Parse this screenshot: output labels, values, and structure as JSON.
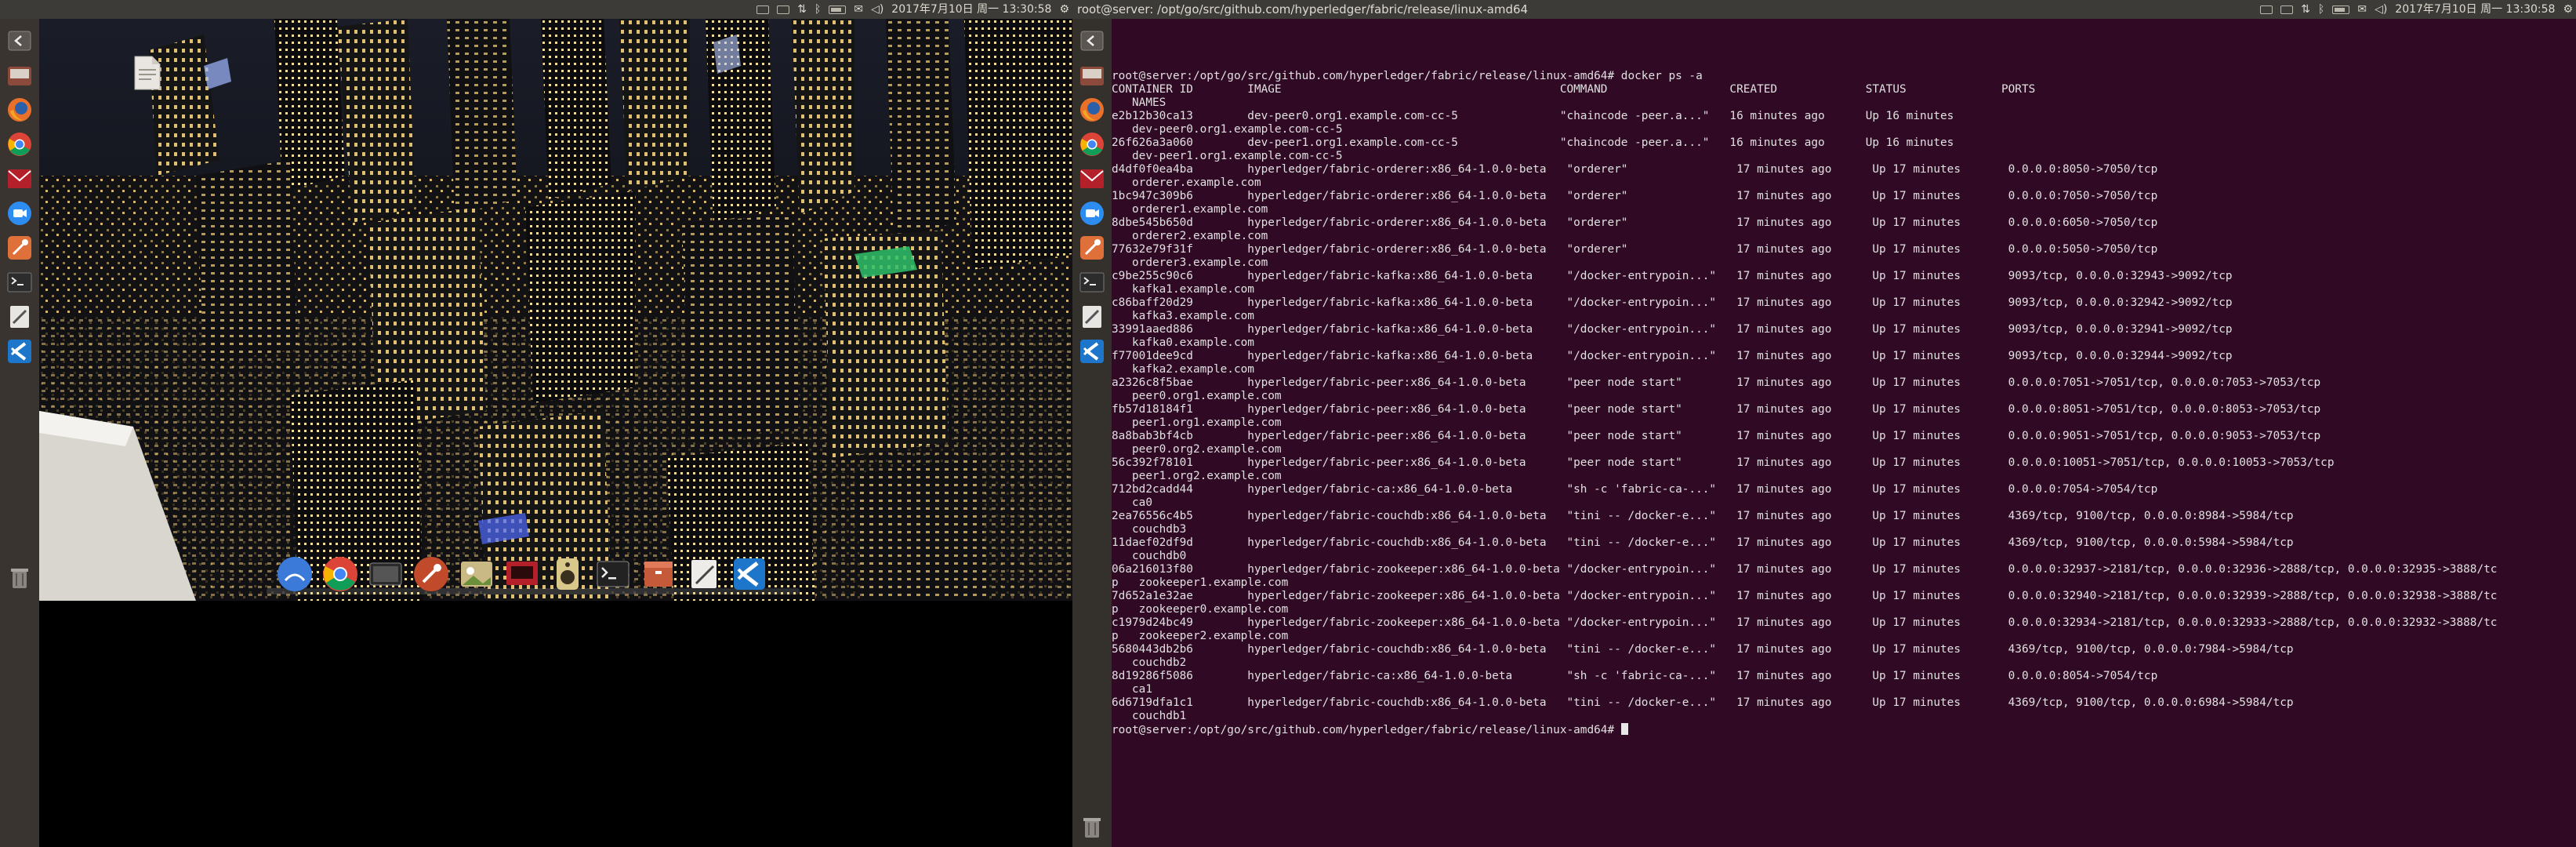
{
  "left_screen": {
    "topbar": {
      "title": "",
      "clock": "2017年7月10日 周一 13:30:58",
      "indicators": [
        "keyboard-icon",
        "network-icon",
        "sort-icon",
        "bluetooth-icon",
        "battery-icon",
        "mail-icon",
        "volume-icon"
      ]
    },
    "launcher_icons": [
      "back-icon",
      "files-icon",
      "firefox-icon",
      "chrome-icon",
      "mail-app-icon",
      "video-call-icon",
      "kite-icon",
      "terminal-icon",
      "editor-icon",
      "vscode-icon",
      "trash-icon"
    ],
    "dock_icons": [
      "finder-icon",
      "chrome-icon",
      "video-icon",
      "rocket-icon",
      "photos-icon",
      "slides-icon",
      "audio-icon",
      "terminal-icon",
      "archive-icon",
      "textedit-icon",
      "vscode-icon"
    ]
  },
  "right_screen": {
    "topbar": {
      "title": "root@server: /opt/go/src/github.com/hyperledger/fabric/release/linux-amd64",
      "clock": "2017年7月10日 周一 13:30:58"
    },
    "terminal": {
      "lines": [
        "root@server:/opt/go/src/github.com/hyperledger/fabric/release/linux-amd64# docker ps -a",
        "CONTAINER ID        IMAGE                                         COMMAND                  CREATED             STATUS              PORTS",
        "   NAMES",
        "e2b12b30ca13        dev-peer0.org1.example.com-cc-5               \"chaincode -peer.a...\"   16 minutes ago      Up 16 minutes",
        "   dev-peer0.org1.example.com-cc-5",
        "26f626a3a060        dev-peer1.org1.example.com-cc-5               \"chaincode -peer.a...\"   16 minutes ago      Up 16 minutes",
        "   dev-peer1.org1.example.com-cc-5",
        "d4df0f0ea4ba        hyperledger/fabric-orderer:x86_64-1.0.0-beta   \"orderer\"                17 minutes ago      Up 17 minutes       0.0.0.0:8050->7050/tcp",
        "   orderer.example.com",
        "1bc947c309b6        hyperledger/fabric-orderer:x86_64-1.0.0-beta   \"orderer\"                17 minutes ago      Up 17 minutes       0.0.0.0:7050->7050/tcp",
        "   orderer1.example.com",
        "8dbe545b650d        hyperledger/fabric-orderer:x86_64-1.0.0-beta   \"orderer\"                17 minutes ago      Up 17 minutes       0.0.0.0:6050->7050/tcp",
        "   orderer2.example.com",
        "77632e79f31f        hyperledger/fabric-orderer:x86_64-1.0.0-beta   \"orderer\"                17 minutes ago      Up 17 minutes       0.0.0.0:5050->7050/tcp",
        "   orderer3.example.com",
        "c9be255c90c6        hyperledger/fabric-kafka:x86_64-1.0.0-beta     \"/docker-entrypoin...\"   17 minutes ago      Up 17 minutes       9093/tcp, 0.0.0.0:32943->9092/tcp",
        "   kafka1.example.com",
        "c86baff20d29        hyperledger/fabric-kafka:x86_64-1.0.0-beta     \"/docker-entrypoin...\"   17 minutes ago      Up 17 minutes       9093/tcp, 0.0.0.0:32942->9092/tcp",
        "   kafka3.example.com",
        "33991aaed886        hyperledger/fabric-kafka:x86_64-1.0.0-beta     \"/docker-entrypoin...\"   17 minutes ago      Up 17 minutes       9093/tcp, 0.0.0.0:32941->9092/tcp",
        "   kafka0.example.com",
        "f77001dee9cd        hyperledger/fabric-kafka:x86_64-1.0.0-beta     \"/docker-entrypoin...\"   17 minutes ago      Up 17 minutes       9093/tcp, 0.0.0.0:32944->9092/tcp",
        "   kafka2.example.com",
        "a2326c8f5bae        hyperledger/fabric-peer:x86_64-1.0.0-beta      \"peer node start\"        17 minutes ago      Up 17 minutes       0.0.0.0:7051->7051/tcp, 0.0.0.0:7053->7053/tcp",
        "   peer0.org1.example.com",
        "fb57d18184f1        hyperledger/fabric-peer:x86_64-1.0.0-beta      \"peer node start\"        17 minutes ago      Up 17 minutes       0.0.0.0:8051->7051/tcp, 0.0.0.0:8053->7053/tcp",
        "   peer1.org1.example.com",
        "8a8bab3bf4cb        hyperledger/fabric-peer:x86_64-1.0.0-beta      \"peer node start\"        17 minutes ago      Up 17 minutes       0.0.0.0:9051->7051/tcp, 0.0.0.0:9053->7053/tcp",
        "   peer0.org2.example.com",
        "56c392f78101        hyperledger/fabric-peer:x86_64-1.0.0-beta      \"peer node start\"        17 minutes ago      Up 17 minutes       0.0.0.0:10051->7051/tcp, 0.0.0.0:10053->7053/tcp",
        "   peer1.org2.example.com",
        "712bd2cadd44        hyperledger/fabric-ca:x86_64-1.0.0-beta        \"sh -c 'fabric-ca-...\"   17 minutes ago      Up 17 minutes       0.0.0.0:7054->7054/tcp",
        "   ca0",
        "2ea76556c4b5        hyperledger/fabric-couchdb:x86_64-1.0.0-beta   \"tini -- /docker-e...\"   17 minutes ago      Up 17 minutes       4369/tcp, 9100/tcp, 0.0.0.0:8984->5984/tcp",
        "   couchdb3",
        "11daef02df9d        hyperledger/fabric-couchdb:x86_64-1.0.0-beta   \"tini -- /docker-e...\"   17 minutes ago      Up 17 minutes       4369/tcp, 9100/tcp, 0.0.0.0:5984->5984/tcp",
        "   couchdb0",
        "06a216013f80        hyperledger/fabric-zookeeper:x86_64-1.0.0-beta \"/docker-entrypoin...\"   17 minutes ago      Up 17 minutes       0.0.0.0:32937->2181/tcp, 0.0.0.0:32936->2888/tcp, 0.0.0.0:32935->3888/tc",
        "p   zookeeper1.example.com",
        "7d652a1e32ae        hyperledger/fabric-zookeeper:x86_64-1.0.0-beta \"/docker-entrypoin...\"   17 minutes ago      Up 17 minutes       0.0.0.0:32940->2181/tcp, 0.0.0.0:32939->2888/tcp, 0.0.0.0:32938->3888/tc",
        "p   zookeeper0.example.com",
        "c1979d24bc49        hyperledger/fabric-zookeeper:x86_64-1.0.0-beta \"/docker-entrypoin...\"   17 minutes ago      Up 17 minutes       0.0.0.0:32934->2181/tcp, 0.0.0.0:32933->2888/tcp, 0.0.0.0:32932->3888/tc",
        "p   zookeeper2.example.com",
        "5680443db2b6        hyperledger/fabric-couchdb:x86_64-1.0.0-beta   \"tini -- /docker-e...\"   17 minutes ago      Up 17 minutes       4369/tcp, 9100/tcp, 0.0.0.0:7984->5984/tcp",
        "   couchdb2",
        "8d19286f5086        hyperledger/fabric-ca:x86_64-1.0.0-beta        \"sh -c 'fabric-ca-...\"   17 minutes ago      Up 17 minutes       0.0.0.0:8054->7054/tcp",
        "   ca1",
        "6d6719dfa1c1        hyperledger/fabric-couchdb:x86_64-1.0.0-beta   \"tini -- /docker-e...\"   17 minutes ago      Up 17 minutes       4369/tcp, 9100/tcp, 0.0.0.0:6984->5984/tcp",
        "   couchdb1"
      ],
      "prompt": "root@server:/opt/go/src/github.com/hyperledger/fabric/release/linux-amd64# "
    }
  },
  "colors": {
    "terminal_bg": "#300a24",
    "panel_bg": "#3c3b37",
    "launcher_bg": "#34302c"
  }
}
